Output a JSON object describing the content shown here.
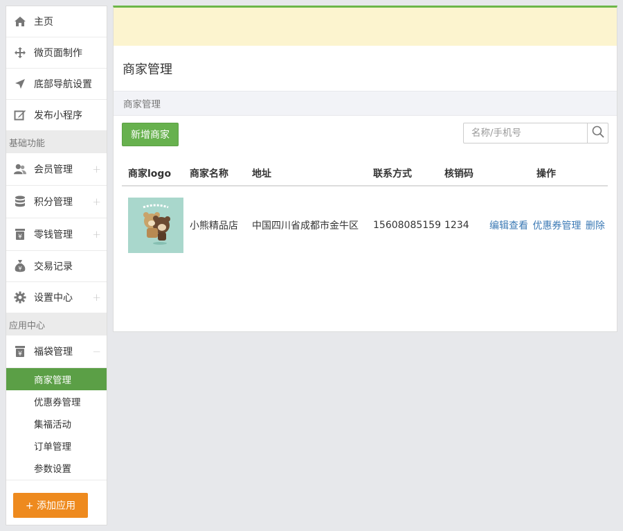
{
  "sidebar": {
    "top_items": [
      {
        "label": "主页",
        "icon": "home-icon"
      },
      {
        "label": "微页面制作",
        "icon": "move-icon"
      },
      {
        "label": "底部导航设置",
        "icon": "location-arrow-icon"
      },
      {
        "label": "发布小程序",
        "icon": "edit-icon"
      }
    ],
    "section_basic": "基础功能",
    "basic_items": [
      {
        "label": "会员管理",
        "icon": "users-icon",
        "toggle": "+"
      },
      {
        "label": "积分管理",
        "icon": "database-icon",
        "toggle": "+"
      },
      {
        "label": "零钱管理",
        "icon": "yen-jar-icon",
        "toggle": "+"
      },
      {
        "label": "交易记录",
        "icon": "money-bag-icon"
      },
      {
        "label": "设置中心",
        "icon": "gear-icon",
        "toggle": "+"
      }
    ],
    "section_apps": "应用中心",
    "app_items": [
      {
        "label": "福袋管理",
        "icon": "yen-jar-icon",
        "toggle": "−"
      }
    ],
    "sub_items": [
      {
        "label": "商家管理",
        "active": true
      },
      {
        "label": "优惠券管理"
      },
      {
        "label": "集福活动"
      },
      {
        "label": "订单管理"
      },
      {
        "label": "参数设置"
      }
    ],
    "add_app_label": "+ 添加应用"
  },
  "main": {
    "title": "商家管理",
    "breadcrumb": "商家管理",
    "add_button": "新增商家",
    "search_placeholder": "名称/手机号",
    "table": {
      "headers": [
        "商家logo",
        "商家名称",
        "地址",
        "联系方式",
        "核销码",
        "操作"
      ],
      "rows": [
        {
          "name": "小熊精品店",
          "address": "中国四川省成都市金牛区",
          "phone": "15608085159",
          "code": "1234",
          "actions": [
            "编辑查看",
            "优惠券管理",
            "删除"
          ]
        }
      ]
    }
  },
  "colors": {
    "accent_green": "#5b9f46",
    "button_green": "#67b14e",
    "orange": "#ee8a1e",
    "link_blue": "#3c7ab5",
    "notice_yellow": "#fcf4cf"
  }
}
